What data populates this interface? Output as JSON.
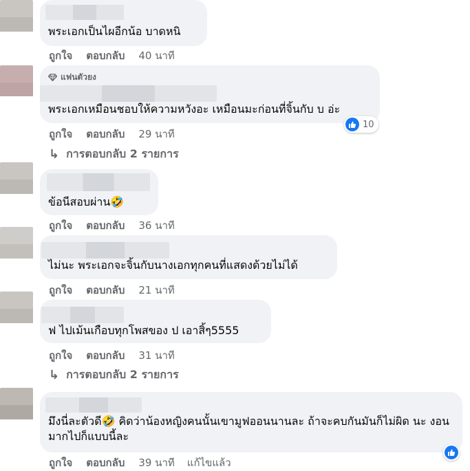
{
  "comments": [
    {
      "text": "พระเอกเป็นไผอีกน้อ บาดหนิ",
      "like": "ถูกใจ",
      "reply": "ตอบกลับ",
      "time": "40 นาที"
    },
    {
      "badge": "แฟนตัวยง",
      "text": "พระเอกเหมือนชอบให้ความหวังอะ เหมือนมะก่อนที่จิ้นกับ บ อ่ะ",
      "like": "ถูกใจ",
      "reply": "ตอบกลับ",
      "time": "29 นาที",
      "reactions": "10",
      "replies": "การตอบกลับ 2 รายการ"
    },
    {
      "text": "ข้อนีสอบผ่าน🤣",
      "like": "ถูกใจ",
      "reply": "ตอบกลับ",
      "time": "36 นาที"
    },
    {
      "text": "ไม่นะ พระเอกจะจิ้นกับนางเอกทุกคนที่แสดงด้วยไม่ได้",
      "like": "ถูกใจ",
      "reply": "ตอบกลับ",
      "time": "21 นาที"
    },
    {
      "text": "ฟ ไปเม้นเกือบทุกโพสของ ป เอาสิ้ๆ5555",
      "like": "ถูกใจ",
      "reply": "ตอบกลับ",
      "time": "31 นาที",
      "replies": "การตอบกลับ 2 รายการ"
    },
    {
      "text": "มึงนี่ละตัวดี🤣 คิดว่าน้องหญิงคนนั้นเขามูฟออนนานละ ถ้าจะคบกันมันก็ไม่ผิด นะ งอนมากไปก็แบบนี้ละ",
      "like": "ถูกใจ",
      "reply": "ตอบกลับ",
      "time": "39 นาที",
      "edited": "แก้ไขแล้ว"
    }
  ],
  "colors": {
    "bubble": "#f0f2f5",
    "secondary_text": "#65676b",
    "like_blue": "#1877f2"
  },
  "icons": {
    "fan_badge": "diamond-icon",
    "replies_arrow": "reply-arrow-icon",
    "reaction": "like-icon"
  }
}
